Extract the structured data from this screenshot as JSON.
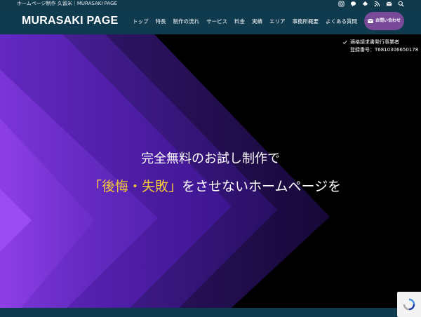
{
  "topbar": {
    "tagline": "ホームページ制作 久留米｜MURASAKI PAGE",
    "icons": [
      "instagram-icon",
      "line-icon",
      "feedly-icon",
      "rss-icon",
      "mail-icon",
      "search-icon"
    ]
  },
  "header": {
    "logo": "MURASAKI PAGE",
    "nav": [
      "トップ",
      "特長",
      "制作の流れ",
      "サービス",
      "料金",
      "実績",
      "エリア",
      "事務所概要",
      "よくある質問"
    ],
    "contact_button": "お問い合わせ"
  },
  "hero": {
    "invoice_line1": "適格請求書発行事業者",
    "invoice_line2": "登録番号：T6810306650178",
    "headline1": "完全無料のお試し制作で",
    "headline2_highlight": "「後悔・失敗」",
    "headline2_rest": "をさせないホームページを"
  },
  "colors": {
    "header_bg": "#103b4e",
    "accent_purple": "#7a4a9a",
    "highlight_yellow": "#f4c83a"
  }
}
